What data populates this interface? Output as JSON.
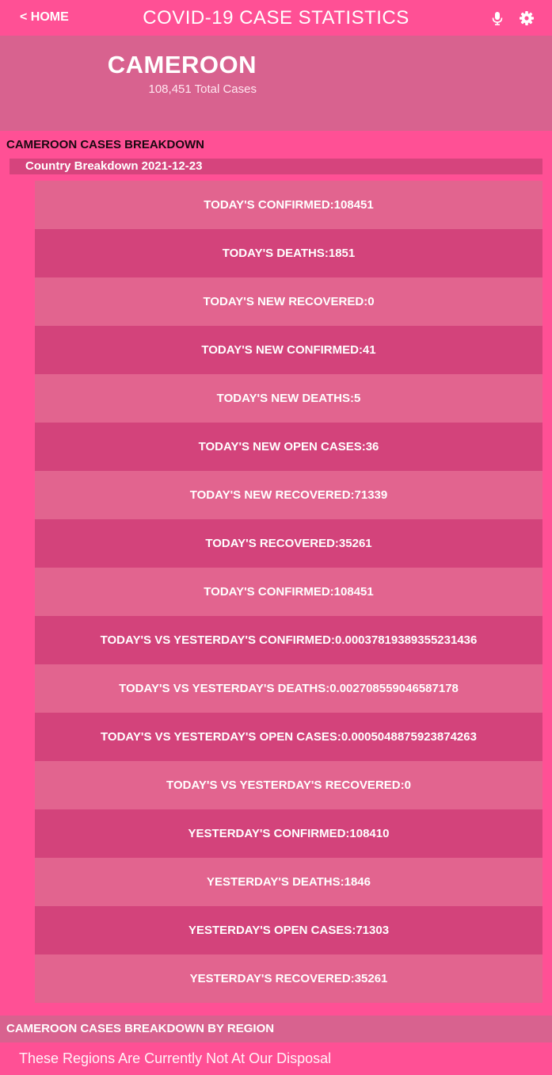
{
  "header": {
    "back_label": "< HOME",
    "title": "COVID-19 CASE STATISTICS",
    "icons": [
      "microphone-icon",
      "gear-icon"
    ]
  },
  "hero": {
    "country": "CAMEROON",
    "total_cases": "108,451 Total Cases"
  },
  "breakdown": {
    "title": "CAMEROON CASES BREAKDOWN",
    "subtitle": "Country Breakdown 2021-12-23",
    "rows": [
      "TODAY'S CONFIRMED:108451",
      "TODAY'S DEATHS:1851",
      "TODAY'S NEW RECOVERED:0",
      "TODAY'S NEW CONFIRMED:41",
      "TODAY'S NEW DEATHS:5",
      "TODAY'S NEW OPEN CASES:36",
      "TODAY'S NEW RECOVERED:71339",
      "TODAY'S RECOVERED:35261",
      "TODAY'S CONFIRMED:108451",
      "TODAY'S VS YESTERDAY'S CONFIRMED:0.00037819389355231436",
      "TODAY'S VS YESTERDAY'S DEATHS:0.002708559046587178",
      "TODAY'S VS YESTERDAY'S OPEN CASES:0.0005048875923874263",
      "TODAY'S VS YESTERDAY'S RECOVERED:0",
      "YESTERDAY'S CONFIRMED:108410",
      "YESTERDAY'S DEATHS:1846",
      "YESTERDAY'S OPEN CASES:71303",
      "YESTERDAY'S RECOVERED:35261"
    ]
  },
  "regions": {
    "title": "CAMEROON CASES BREAKDOWN BY REGION",
    "message": "These Regions Are Currently Not At Our Disposal"
  },
  "colors": {
    "background": "#ff5095",
    "hero": "#d8628f",
    "row_light": "#e2648f",
    "row_dark": "#d3437b"
  }
}
